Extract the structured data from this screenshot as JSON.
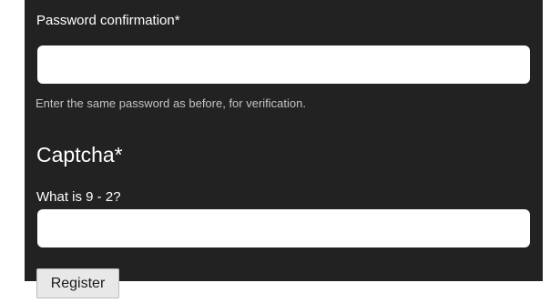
{
  "form": {
    "password_confirmation": {
      "label": "Password confirmation*",
      "value": "",
      "help_text": "Enter the same password as before, for verification."
    },
    "captcha": {
      "heading": "Captcha*",
      "question": "What is 9 - 2?",
      "value": ""
    },
    "register_label": "Register"
  },
  "colors": {
    "panel_background": "#222222",
    "label_text": "#ffffff",
    "help_text": "#c4c4c4",
    "input_background": "#ffffff",
    "button_background": "#e8e8e8"
  }
}
